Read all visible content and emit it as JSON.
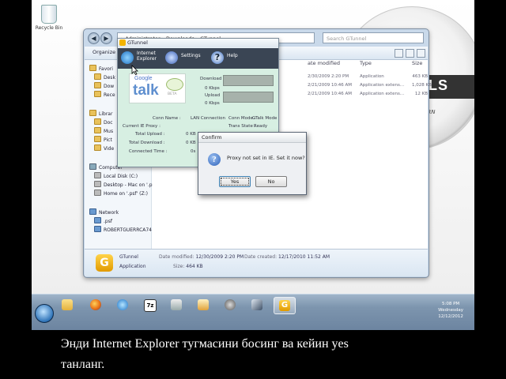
{
  "desktop": {
    "recycle_label": "Recycle Bin",
    "wallpaper_text": "ALS",
    "wallpaper_sub": "ERN"
  },
  "explorer": {
    "breadcrumb": "▸ Administrator ▸ Downloads ▸ GTunnel",
    "search_placeholder": "Search GTunnel",
    "toolbar_label": "Organize",
    "columns": [
      "ate modified",
      "Type",
      "Size"
    ],
    "rows": [
      {
        "date": "2/30/2009 2:20 PM",
        "type": "Application",
        "size": "463 KB"
      },
      {
        "date": "2/21/2009 10:46 AM",
        "type": "Application extens...",
        "size": "1,028 KB"
      },
      {
        "date": "2/21/2009 10:46 AM",
        "type": "Application extens...",
        "size": "12 KB"
      }
    ],
    "nav": [
      {
        "label": "Favori",
        "icon": "star-icon"
      },
      {
        "label": "Desk",
        "icon": "folder-icon"
      },
      {
        "label": "Dow",
        "icon": "folder-icon"
      },
      {
        "label": "Rece",
        "icon": "folder-icon"
      },
      {
        "label": "Librar",
        "icon": "library-icon"
      },
      {
        "label": "Doc",
        "icon": "folder-icon"
      },
      {
        "label": "Mus",
        "icon": "folder-icon"
      },
      {
        "label": "Pict",
        "icon": "folder-icon"
      },
      {
        "label": "Vide",
        "icon": "folder-icon"
      },
      {
        "label": "Computer",
        "icon": "computer-icon"
      },
      {
        "label": "Local Disk (C:)",
        "icon": "drive-icon"
      },
      {
        "label": "Desktop - Mac on '.p",
        "icon": "drive-icon"
      },
      {
        "label": "Home on '.psf' (Z:)",
        "icon": "drive-icon"
      },
      {
        "label": "Network",
        "icon": "network-icon"
      },
      {
        "label": ".psf",
        "icon": "network-icon"
      },
      {
        "label": "ROBERTGUERRCA74",
        "icon": "network-icon"
      }
    ],
    "details": {
      "name": "GTunnel",
      "type": "Application",
      "date_modified_label": "Date modified:",
      "date_modified": "12/30/2009 2:20 PM",
      "date_created_label": "Date created:",
      "date_created": "12/17/2010 11:52 AM",
      "size_label": "Size:",
      "size": "464 KB"
    }
  },
  "gtunnel": {
    "title": "GTunnel",
    "tabs": [
      {
        "label": "Internet\nExplorer"
      },
      {
        "label": "Settings"
      },
      {
        "label": "Help"
      }
    ],
    "download_label": "Download",
    "download_rate": "0 Kbps",
    "upload_label": "Upload",
    "upload_rate": "0 Kbps",
    "conn_name_label": "Conn Name :",
    "conn_name": "LAN Connection",
    "conn_mode_label": "Conn Mode :",
    "conn_mode": "GTalk Mode",
    "ie_proxy_label": "Current IE Proxy :",
    "trans_state_label": "Trans State :",
    "trans_state": "Ready",
    "total_upload_label": "Total Upload :",
    "total_upload": "0 KB",
    "total_download_label": "Total Download :",
    "total_download": "0 KB",
    "connected_time_label": "Connected Time :",
    "connected_time": "0s",
    "logo_google": "Google",
    "logo_talk": "talk",
    "logo_beta": "BETA"
  },
  "confirm": {
    "title": "Confirm",
    "message": "Proxy not set in IE. Set it now?",
    "yes": "Yes",
    "no": "No"
  },
  "taskbar": {
    "items": [
      "explorer-icon",
      "firefox-icon",
      "ie-icon",
      "7zip-icon",
      "tool-icon",
      "media-icon",
      "settings-icon",
      "telescope-icon",
      "gtunnel-icon"
    ],
    "time": "5:08 PM",
    "day": "Wednesday",
    "date": "12/12/2012"
  },
  "caption": {
    "line1": "Энди Internet Explorer тугмасини босинг ва кейин yes",
    "line2": "танланг."
  }
}
